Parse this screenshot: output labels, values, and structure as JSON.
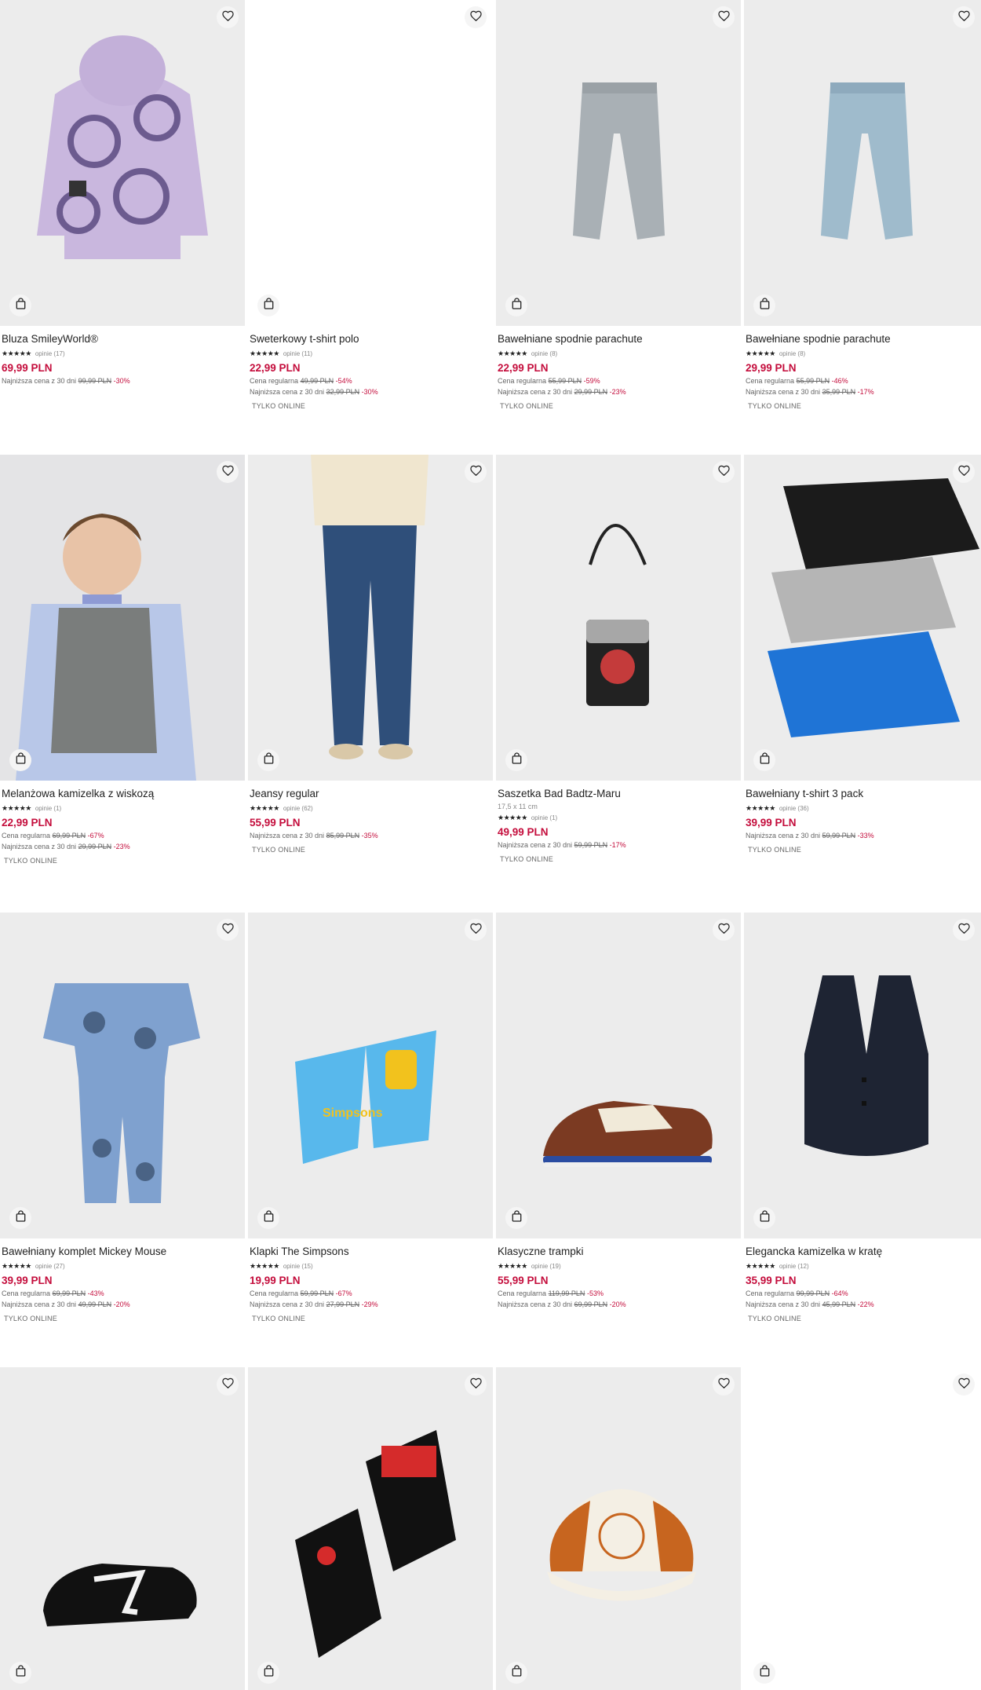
{
  "products": [
    {
      "name": "Bluza SmileyWorld®",
      "stars": "★★★★★",
      "reviews": "opinie (17)",
      "price": "69,99 PLN",
      "lines": [
        {
          "label": "Najniższa cena z 30 dni",
          "old": "99,99 PLN",
          "disc": "-30%"
        }
      ],
      "badge": ""
    },
    {
      "name": "Sweterkowy t-shirt polo",
      "stars": "★★★★★",
      "reviews": "opinie (11)",
      "price": "22,99 PLN",
      "lines": [
        {
          "label": "Cena regularna",
          "old": "49,99 PLN",
          "disc": "-54%"
        },
        {
          "label": "Najniższa cena z 30 dni",
          "old": "32,99 PLN",
          "disc": "-30%"
        }
      ],
      "badge": "TYLKO ONLINE"
    },
    {
      "name": "Bawełniane spodnie parachute",
      "stars": "★★★★★",
      "reviews": "opinie (8)",
      "price": "22,99 PLN",
      "lines": [
        {
          "label": "Cena regularna",
          "old": "55,99 PLN",
          "disc": "-59%"
        },
        {
          "label": "Najniższa cena z 30 dni",
          "old": "29,99 PLN",
          "disc": "-23%"
        }
      ],
      "badge": "TYLKO ONLINE"
    },
    {
      "name": "Bawełniane spodnie parachute",
      "stars": "★★★★★",
      "reviews": "opinie (8)",
      "price": "29,99 PLN",
      "lines": [
        {
          "label": "Cena regularna",
          "old": "55,99 PLN",
          "disc": "-46%"
        },
        {
          "label": "Najniższa cena z 30 dni",
          "old": "35,99 PLN",
          "disc": "-17%"
        }
      ],
      "badge": "TYLKO ONLINE"
    },
    {
      "name": "Melanżowa kamizelka z wiskozą",
      "stars": "★★★★★",
      "reviews": "opinie (1)",
      "price": "22,99 PLN",
      "lines": [
        {
          "label": "Cena regularna",
          "old": "69,99 PLN",
          "disc": "-67%"
        },
        {
          "label": "Najniższa cena z 30 dni",
          "old": "29,99 PLN",
          "disc": "-23%"
        }
      ],
      "badge": "TYLKO ONLINE"
    },
    {
      "name": "Jeansy regular",
      "stars": "★★★★★",
      "reviews": "opinie (62)",
      "price": "55,99 PLN",
      "lines": [
        {
          "label": "Najniższa cena z 30 dni",
          "old": "85,99 PLN",
          "disc": "-35%"
        }
      ],
      "badge": "TYLKO ONLINE"
    },
    {
      "name": "Saszetka Bad Badtz-Maru",
      "size": "17,5 x 11 cm",
      "stars": "★★★★★",
      "reviews": "opinie (1)",
      "price": "49,99 PLN",
      "lines": [
        {
          "label": "Najniższa cena z 30 dni",
          "old": "59,99 PLN",
          "disc": "-17%"
        }
      ],
      "badge": "TYLKO ONLINE"
    },
    {
      "name": "Bawełniany t-shirt 3 pack",
      "stars": "★★★★★",
      "reviews": "opinie (36)",
      "price": "39,99 PLN",
      "lines": [
        {
          "label": "Najniższa cena z 30 dni",
          "old": "59,99 PLN",
          "disc": "-33%"
        }
      ],
      "badge": "TYLKO ONLINE"
    },
    {
      "name": "Bawełniany komplet Mickey Mouse",
      "stars": "★★★★★",
      "reviews": "opinie (27)",
      "price": "39,99 PLN",
      "lines": [
        {
          "label": "Cena regularna",
          "old": "69,99 PLN",
          "disc": "-43%"
        },
        {
          "label": "Najniższa cena z 30 dni",
          "old": "49,99 PLN",
          "disc": "-20%"
        }
      ],
      "badge": "TYLKO ONLINE"
    },
    {
      "name": "Klapki The Simpsons",
      "stars": "★★★★★",
      "reviews": "opinie (15)",
      "price": "19,99 PLN",
      "lines": [
        {
          "label": "Cena regularna",
          "old": "59,99 PLN",
          "disc": "-67%"
        },
        {
          "label": "Najniższa cena z 30 dni",
          "old": "27,99 PLN",
          "disc": "-29%"
        }
      ],
      "badge": "TYLKO ONLINE"
    },
    {
      "name": "Klasyczne trampki",
      "stars": "★★★★★",
      "reviews": "opinie (19)",
      "price": "55,99 PLN",
      "lines": [
        {
          "label": "Cena regularna",
          "old": "119,99 PLN",
          "disc": "-53%"
        },
        {
          "label": "Najniższa cena z 30 dni",
          "old": "69,99 PLN",
          "disc": "-20%"
        }
      ],
      "badge": ""
    },
    {
      "name": "Elegancka kamizelka w kratę",
      "stars": "★★★★★",
      "reviews": "opinie (12)",
      "price": "35,99 PLN",
      "lines": [
        {
          "label": "Cena regularna",
          "old": "99,99 PLN",
          "disc": "-64%"
        },
        {
          "label": "Najniższa cena z 30 dni",
          "old": "45,99 PLN",
          "disc": "-22%"
        }
      ],
      "badge": "TYLKO ONLINE"
    },
    {
      "name": "",
      "stars": "",
      "reviews": "",
      "price": "",
      "lines": [],
      "badge": ""
    },
    {
      "name": "",
      "stars": "",
      "reviews": "",
      "price": "",
      "lines": [],
      "badge": ""
    },
    {
      "name": "",
      "stars": "",
      "reviews": "",
      "price": "",
      "lines": [],
      "badge": ""
    },
    {
      "name": "",
      "stars": "",
      "reviews": "",
      "price": "",
      "lines": [],
      "badge": ""
    }
  ],
  "icons": {
    "favorite": "heart-icon",
    "cart": "shopping-bag-icon"
  },
  "colors": {
    "price": "#c40d3c",
    "discount": "#c40d3c",
    "image_bg": "#ececec"
  }
}
